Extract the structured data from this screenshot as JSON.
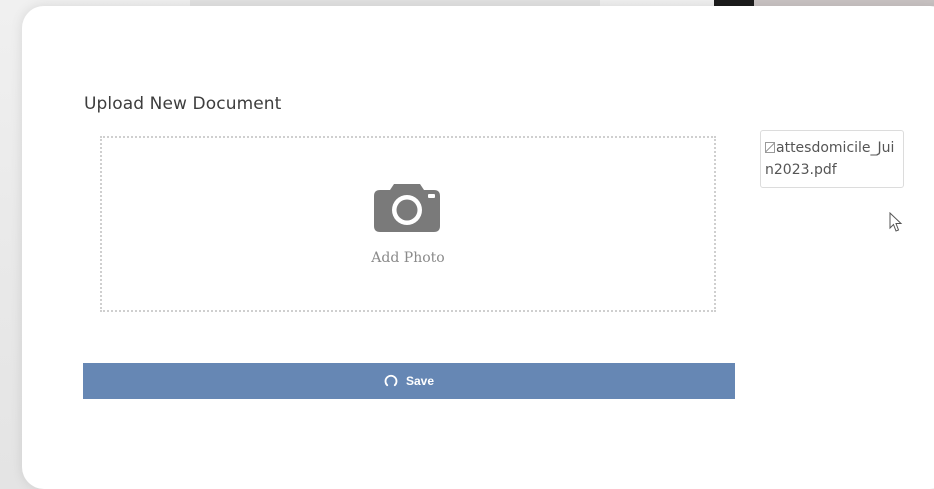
{
  "dialog": {
    "title": "Upload New Document"
  },
  "dropzone": {
    "icon": "camera-icon",
    "label": "Add Photo"
  },
  "attachment": {
    "icon": "broken-image-icon",
    "file_name": "attesdomicile_Juin2023.pdf"
  },
  "actions": {
    "save_label": "Save",
    "save_icon": "spinner-icon",
    "save_color": "#6687b4"
  },
  "colors": {
    "modal_background": "#ffffff",
    "title_text": "#3d3d3d",
    "dropzone_border": "#cfcfcf",
    "camera_icon": "#7a7a7a"
  }
}
